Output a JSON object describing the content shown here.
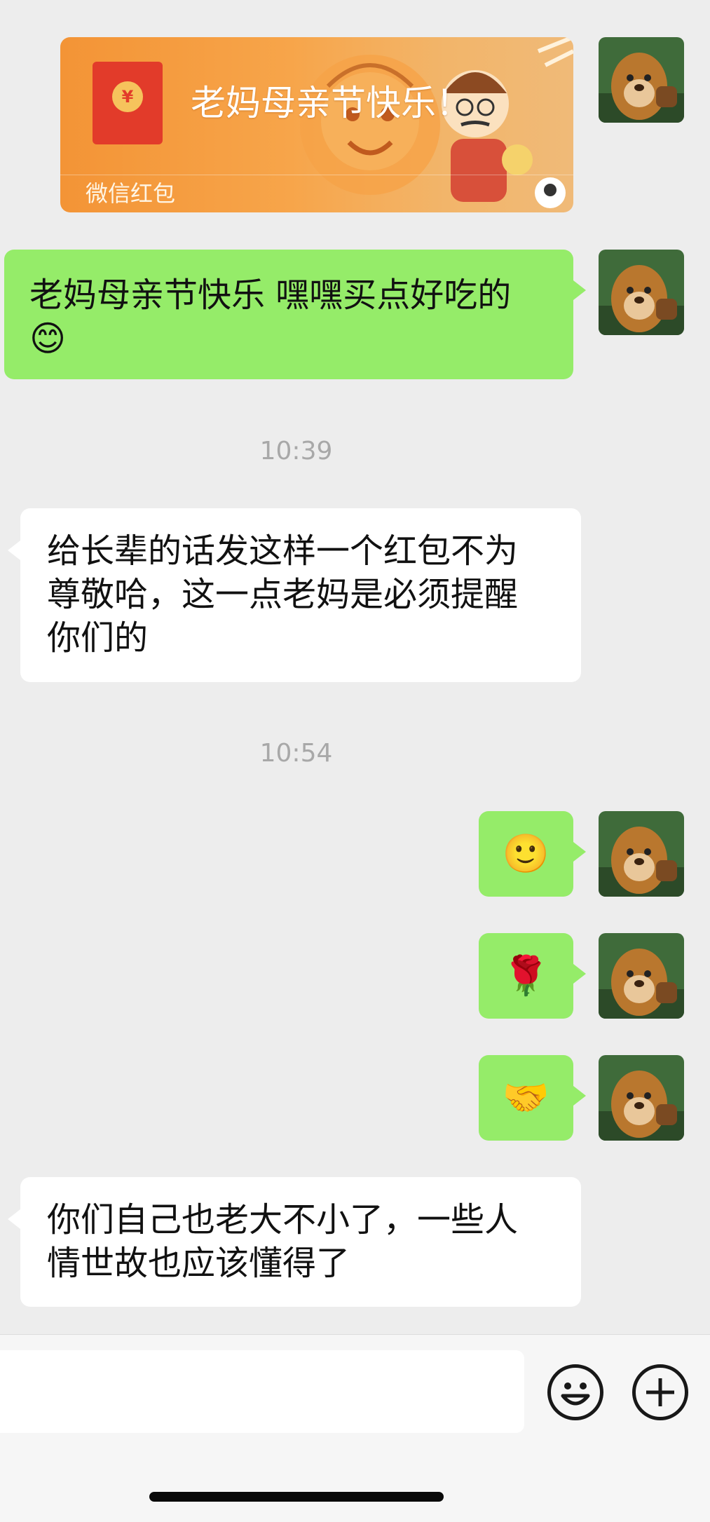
{
  "red_packet": {
    "title": "老妈母亲节快乐！",
    "label": "微信红包",
    "coin_symbol": "¥"
  },
  "messages": [
    {
      "sender": "me",
      "text_line1": "老妈母亲节快乐 嘿嘿买点好吃的",
      "emoji": "😊"
    },
    {
      "time": "10:39"
    },
    {
      "sender": "other",
      "lines": [
        "给长辈的话发这样一个红包不为",
        "尊敬哈，这一点老妈是必须提醒",
        "你们的"
      ]
    },
    {
      "time": "10:54"
    },
    {
      "sender": "me",
      "emoji": "🙂"
    },
    {
      "sender": "me",
      "emoji": "🌹"
    },
    {
      "sender": "me",
      "emoji": "🤝"
    },
    {
      "sender": "other",
      "lines": [
        "你们自己也老大不小了，一些人",
        "情世故也应该懂得了"
      ]
    }
  ],
  "colors": {
    "background": "#ededed",
    "my_bubble": "#95ec69",
    "other_bubble": "#ffffff",
    "red_packet": "#f39436"
  },
  "input_bar": {
    "emoji_button_icon": "smiley-face-icon",
    "more_button_icon": "plus-icon"
  }
}
